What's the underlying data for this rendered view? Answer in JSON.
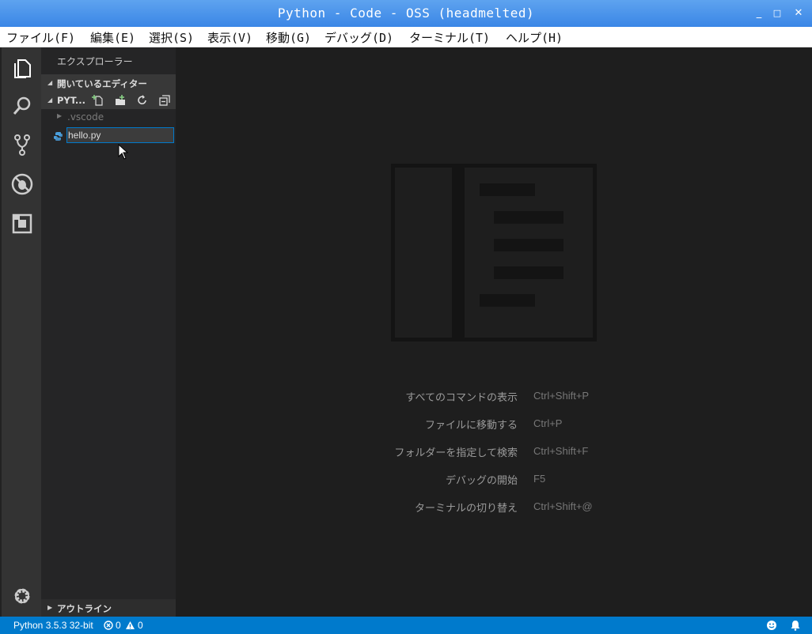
{
  "window": {
    "title": "Python - Code - OSS (headmelted)",
    "minimize": "_",
    "maximize": "□",
    "close": "✕"
  },
  "menu": [
    "ファイル(F)",
    "編集(E)",
    "選択(S)",
    "表示(V)",
    "移動(G)",
    "デバッグ(D)",
    "ターミナル(T)",
    "ヘルプ(H)"
  ],
  "sidebar": {
    "title": "エクスプローラー",
    "open_editors": "開いているエディター",
    "folder": "PYT...",
    "items": [
      {
        "name": ".vscode",
        "type": "folder"
      },
      {
        "name": "hello.py",
        "type": "python-file",
        "renaming": true
      }
    ],
    "outline": "アウトライン"
  },
  "editor": {
    "shortcuts": [
      {
        "label": "すべてのコマンドの表示",
        "keys": "Ctrl+Shift+P"
      },
      {
        "label": "ファイルに移動する",
        "keys": "Ctrl+P"
      },
      {
        "label": "フォルダーを指定して検索",
        "keys": "Ctrl+Shift+F"
      },
      {
        "label": "デバッグの開始",
        "keys": "F5"
      },
      {
        "label": "ターミナルの切り替え",
        "keys": "Ctrl+Shift+@"
      }
    ]
  },
  "statusbar": {
    "interpreter": "Python 3.5.3 32-bit",
    "errors": "0",
    "warnings": "0"
  },
  "colors": {
    "accent": "#007acc",
    "titlebar": "#3a86e6",
    "sidebar": "#252526",
    "editor": "#1e1e1e"
  }
}
